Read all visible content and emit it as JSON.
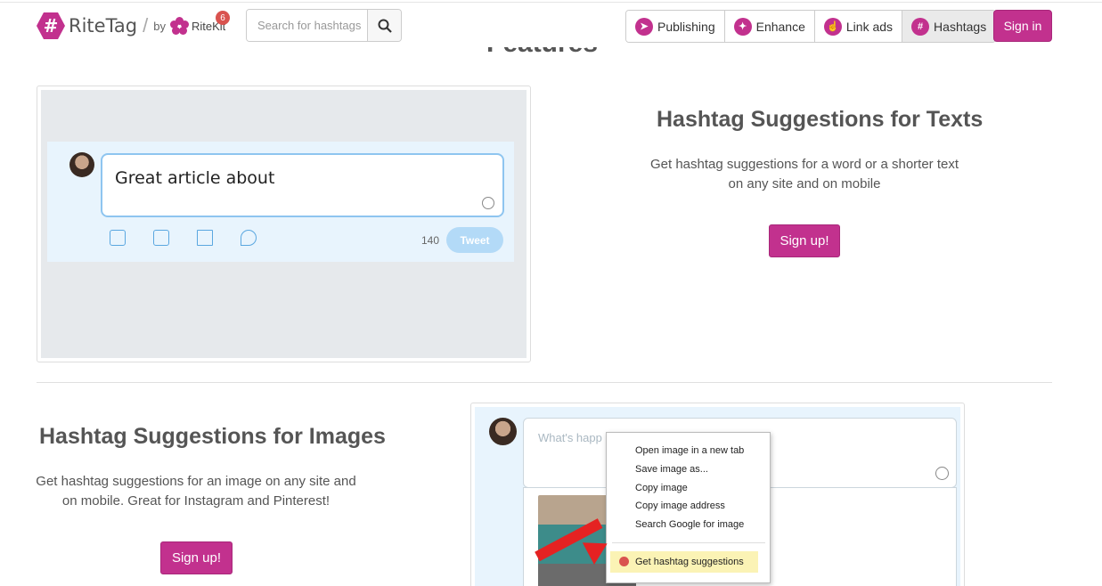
{
  "header": {
    "logo_text": "RiteTag",
    "logo_mark": "#",
    "by_label": "by",
    "brand": "RiteKit",
    "badge_count": "6",
    "search_placeholder": "Search for hashtags",
    "nav": [
      {
        "label": "Publishing",
        "icon": "paper-plane-icon"
      },
      {
        "label": "Enhance",
        "icon": "magic-wand-icon"
      },
      {
        "label": "Link ads",
        "icon": "hand-pointer-icon"
      },
      {
        "label": "Hashtags",
        "icon": "hashtag-icon"
      }
    ],
    "signin": "Sign in",
    "accent": "#c2318e"
  },
  "page": {
    "features_title": "Features"
  },
  "section1": {
    "title": "Hashtag Suggestions for Texts",
    "desc_line1": "Get hashtag suggestions for a word or a shorter text",
    "desc_line2": "on any site and on mobile",
    "cta": "Sign up!",
    "mock": {
      "composer_text": "Great article about",
      "char_count": "140",
      "tweet_button": "Tweet"
    }
  },
  "section2": {
    "title": "Hashtag Suggestions for Images",
    "desc_line1": "Get hashtag suggestions for an image on any site and",
    "desc_line2": "on mobile. Great for Instagram and Pinterest!",
    "cta": "Sign up!",
    "mock": {
      "composer_placeholder": "What's happ",
      "menu_items": [
        "Open image in a new tab",
        "Save image as...",
        "Copy image",
        "Copy image address",
        "Search Google for image"
      ],
      "highlight_item": "Get hashtag suggestions"
    }
  }
}
